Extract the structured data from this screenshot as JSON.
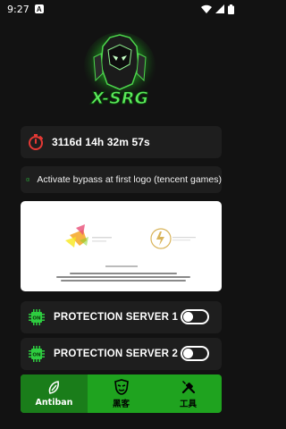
{
  "status_bar": {
    "time": "9:27",
    "notification_icon": "A",
    "icons": [
      "wifi-icon",
      "signal-icon",
      "battery-icon"
    ]
  },
  "logo": {
    "text": "X-SRG",
    "icon": "robot-logo"
  },
  "timer": {
    "icon": "stopwatch-icon",
    "text": "3116d 14h 32m 57s",
    "icon_color": "#e53935"
  },
  "info": {
    "icon": "info-icon",
    "text": "Activate bypass at first logo (tencent games)",
    "icon_color": "#2ecc40"
  },
  "preview": {
    "loading_text": "Starting TYPECOBBLE...",
    "copyright": "COPYRIGHT © 2018 - 2022 TENCENT ALL RIGHTS RESERVED"
  },
  "toggles": [
    {
      "label": "PROTECTION SERVER 1",
      "icon": "chip-icon",
      "chip_text": "ON",
      "enabled": false
    },
    {
      "label": "PROTECTION SERVER 2",
      "icon": "chip-icon",
      "chip_text": "ON",
      "enabled": false
    }
  ],
  "nav": {
    "items": [
      {
        "label": "Antiban",
        "icon": "shield-icon",
        "active": true
      },
      {
        "label": "黑客",
        "icon": "mask-icon",
        "active": false
      },
      {
        "label": "工具",
        "icon": "tools-icon",
        "active": false
      }
    ]
  },
  "colors": {
    "accent": "#1fa31f",
    "accent_dark": "#1a7d1a",
    "card": "#1e1e1e",
    "background": "#121212"
  }
}
